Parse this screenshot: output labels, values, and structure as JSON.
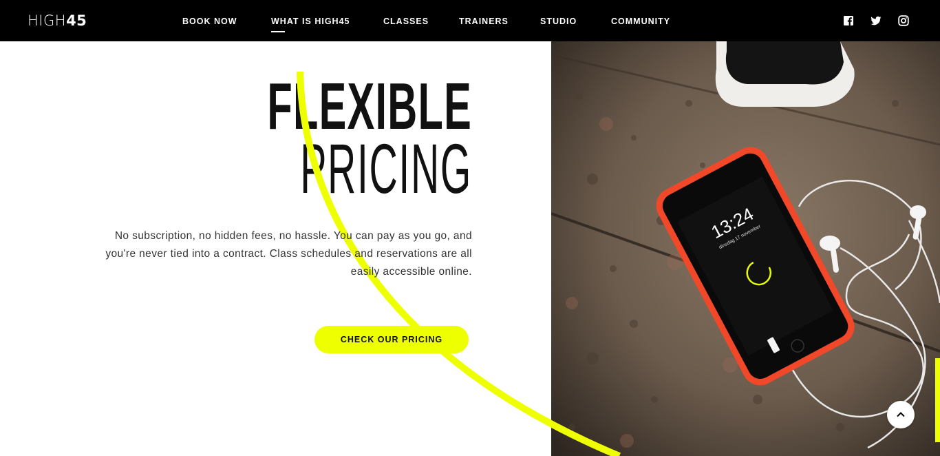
{
  "header": {
    "logo_text": "HIGH",
    "logo_number": "45",
    "nav": [
      {
        "label": "BOOK NOW"
      },
      {
        "label": "WHAT IS HIGH45"
      },
      {
        "label": "CLASSES"
      },
      {
        "label": "TRAINERS"
      },
      {
        "label": "STUDIO"
      },
      {
        "label": "COMMUNITY"
      }
    ],
    "active_nav": "WHAT IS HIGH45",
    "social": [
      "facebook-icon",
      "twitter-icon",
      "instagram-icon"
    ]
  },
  "hero": {
    "title_line1": "FLEXIBLE",
    "title_line2": "PRICING",
    "body": "No subscription, no hidden fees, no hassle. You can pay as you go, and you're never tied into a contract. Class schedules and reservations are all easily accessible online.",
    "cta_label": "CHECK OUR PRICING"
  },
  "phone_screen": {
    "time": "13:24",
    "date": "dinsdag 17 november"
  },
  "colors": {
    "accent": "#eeff00",
    "header_bg": "#000000",
    "text": "#111111"
  },
  "scroll_top_icon": "chevron-up-icon"
}
